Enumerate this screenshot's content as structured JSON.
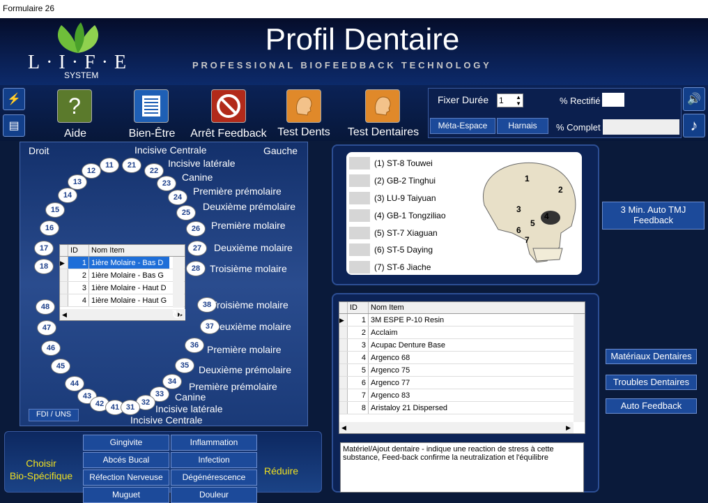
{
  "window": {
    "title": "Formulaire 26"
  },
  "header": {
    "title": "Profil Dentaire",
    "subtitle": "PROFESSIONAL BIOFEEDBACK TECHNOLOGY",
    "logo_text": "L·I·F·E",
    "logo_sub": "SYSTEM"
  },
  "toolbar": {
    "buttons": [
      {
        "label": "Aide",
        "icon": "question-icon",
        "color": "#5b7a2c"
      },
      {
        "label": "Bien-Être",
        "icon": "list-icon",
        "color": "#1e5fb5"
      },
      {
        "label": "Arrêt Feedback",
        "icon": "stop-icon",
        "color": "#b22a1a"
      },
      {
        "label": "Test Dents",
        "icon": "head-icon",
        "color": "#e0892a"
      },
      {
        "label": "Test Dentaires",
        "icon": "head-icon",
        "color": "#e0892a"
      }
    ]
  },
  "controls": {
    "duration_label": "Fixer Durée",
    "duration_value": "1",
    "rectified_label": "% Rectifié",
    "meta_label": "Méta-Espace",
    "harnais_label": "Harnais",
    "complete_label": "% Complet"
  },
  "dental": {
    "droit": "Droit",
    "gauche": "Gauche",
    "fdi_button": "FDI / UNS",
    "upper_labels": [
      "Incisive Centrale",
      "Incisive latérale",
      "Canine",
      "Première prémolaire",
      "Deuxième prémolaire",
      "Première molaire",
      "Deuxième molaire",
      "Troisième molaire"
    ],
    "lower_labels": [
      "Troisième molaire",
      "Deuxième molaire",
      "Première molaire",
      "Deuxième prémolaire",
      "Première prémolaire",
      "Canine",
      "Incisive latérale",
      "Incisive Centrale"
    ],
    "upper_teeth": [
      "11",
      "21",
      "12",
      "22",
      "13",
      "23",
      "14",
      "24",
      "15",
      "25",
      "16",
      "26",
      "17",
      "27",
      "18",
      "28"
    ],
    "lower_teeth": [
      "48",
      "38",
      "47",
      "37",
      "46",
      "36",
      "45",
      "35",
      "44",
      "34",
      "43",
      "33",
      "42",
      "32",
      "41",
      "31"
    ],
    "grid": {
      "headers": [
        "ID",
        "Nom Item"
      ],
      "rows": [
        [
          "1",
          "1ière Molaire - Bas D"
        ],
        [
          "2",
          "1ière Molaire - Bas G"
        ],
        [
          "3",
          "1ière Molaire - Haut D"
        ],
        [
          "4",
          "1ière Molaire - Haut G"
        ]
      ]
    }
  },
  "points": [
    "(1) ST-8 Touwei",
    "(2) GB-2 Tinghui",
    "(3) LU-9 Taiyuan",
    "(4) GB-1 Tongziliao",
    "(5) ST-7 Xiaguan",
    "(6) ST-5 Daying",
    "(7) ST-6 Jiache"
  ],
  "skull_numbers": [
    "1",
    "2",
    "3",
    "4",
    "5",
    "6",
    "7"
  ],
  "tmj_button": "3 Min. Auto TMJ Feedback",
  "materials": {
    "headers": [
      "ID",
      "Nom Item"
    ],
    "rows": [
      [
        "1",
        "3M ESPE P-10 Resin"
      ],
      [
        "2",
        "Acclaim"
      ],
      [
        "3",
        "Acupac Denture Base"
      ],
      [
        "4",
        "Argenco 68"
      ],
      [
        "5",
        "Argenco 75"
      ],
      [
        "6",
        "Argenco 77"
      ],
      [
        "7",
        "Argenco 83"
      ],
      [
        "8",
        "Aristaloy 21 Dispersed"
      ]
    ],
    "description": "Matériel/Ajout dentaire - indique une reaction de stress à cette substance, Feed-back confirme la neutralization et l'équilibre"
  },
  "right_buttons": [
    "Matériaux Dentaires",
    "Troubles Dentaires",
    "Auto Feedback"
  ],
  "bottom": {
    "choose": "Choisir\nBio-Spécifique",
    "reduce": "Réduire",
    "symptoms": [
      [
        "Gingivite",
        "Inflammation"
      ],
      [
        "Abcés Bucal",
        "Infection"
      ],
      [
        "Réfection Nerveuse",
        "Dégénérescence"
      ],
      [
        "Muguet",
        "Douleur"
      ]
    ]
  }
}
